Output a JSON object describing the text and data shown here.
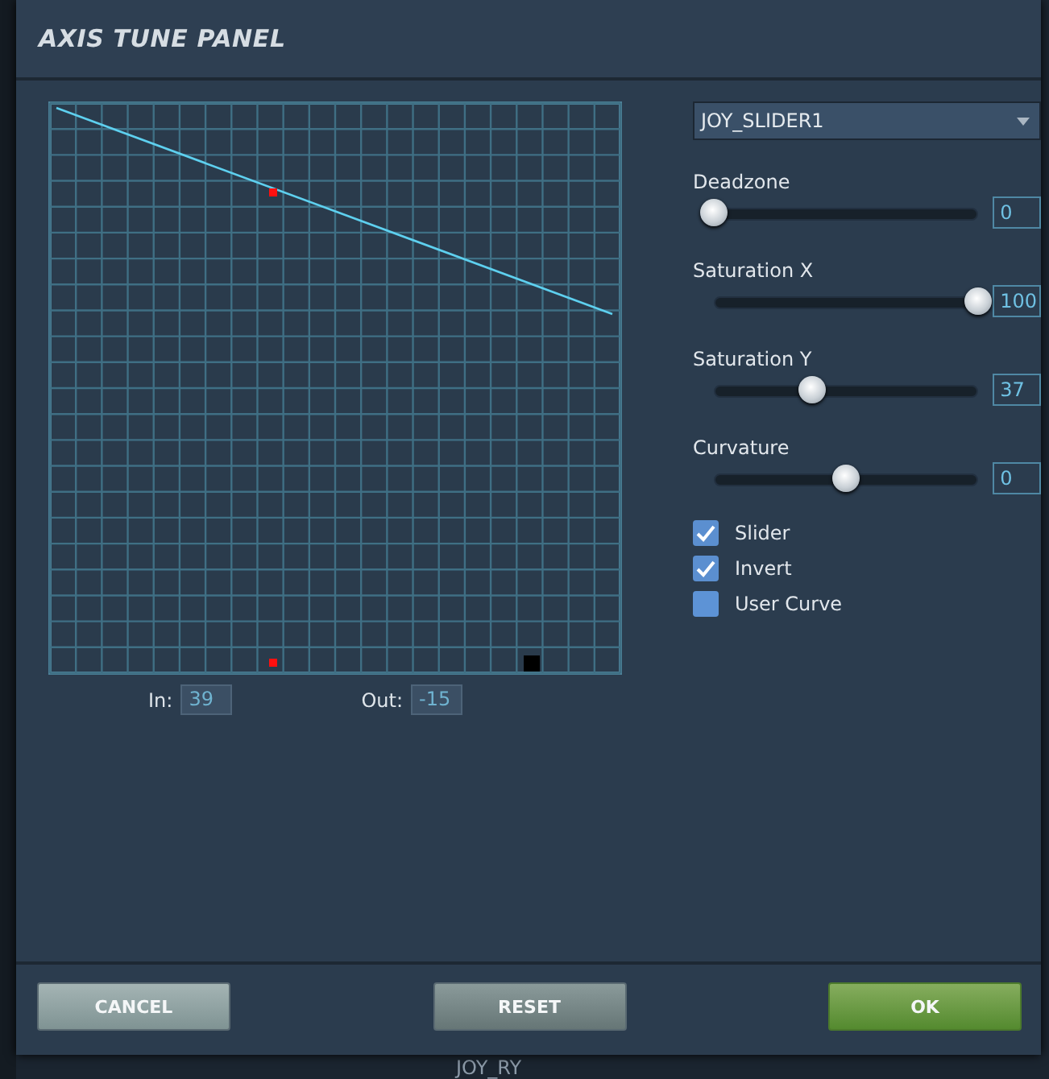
{
  "background": {
    "label": "JOY_RY"
  },
  "window": {
    "title": "AXIS TUNE PANEL"
  },
  "curve": {
    "in_label": "In:",
    "in_value": "39",
    "out_label": "Out:",
    "out_value": "-15"
  },
  "axis_select": {
    "value": "JOY_SLIDER1"
  },
  "sliders": [
    {
      "label": "Deadzone",
      "level": 0,
      "value": "0"
    },
    {
      "label": "Saturation X",
      "level": 1,
      "value": "100"
    },
    {
      "label": "Saturation Y",
      "level": 0.37,
      "value": "37"
    },
    {
      "label": "Curvature",
      "level": 0.5,
      "value": "0"
    }
  ],
  "options": [
    {
      "label": "Slider",
      "checked": true
    },
    {
      "label": "Invert",
      "checked": true
    },
    {
      "label": "User Curve",
      "checked": false
    }
  ],
  "buttons": [
    {
      "label": "CANCEL",
      "kind": "cancel"
    },
    {
      "label": "RESET",
      "kind": "reset"
    },
    {
      "label": "OK",
      "kind": "ok"
    }
  ]
}
